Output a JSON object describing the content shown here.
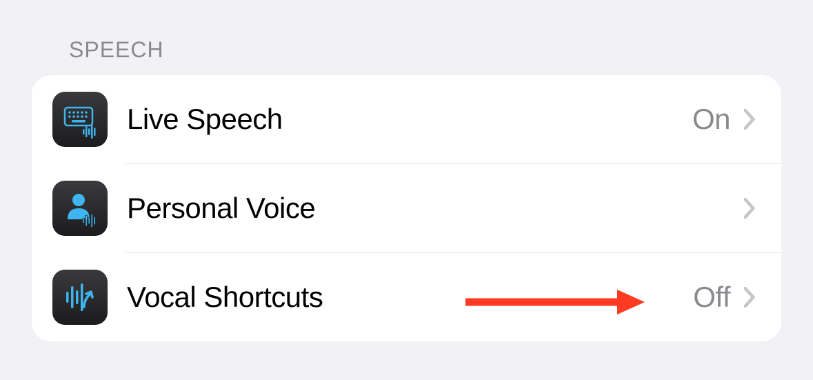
{
  "section": {
    "header": "SPEECH",
    "rows": [
      {
        "icon": "keyboard-wave-icon",
        "label": "Live Speech",
        "value": "On"
      },
      {
        "icon": "person-wave-icon",
        "label": "Personal Voice",
        "value": ""
      },
      {
        "icon": "waveform-arrow-icon",
        "label": "Vocal Shortcuts",
        "value": "Off"
      }
    ]
  },
  "colors": {
    "background": "#f2f1f6",
    "card": "#ffffff",
    "headerText": "#8a8a8e",
    "primaryText": "#000000",
    "secondaryText": "#8a8a8e",
    "iconAccent": "#3fb5f0",
    "iconBg": "#1c1c1e",
    "annotationArrow": "#ff3a22"
  }
}
